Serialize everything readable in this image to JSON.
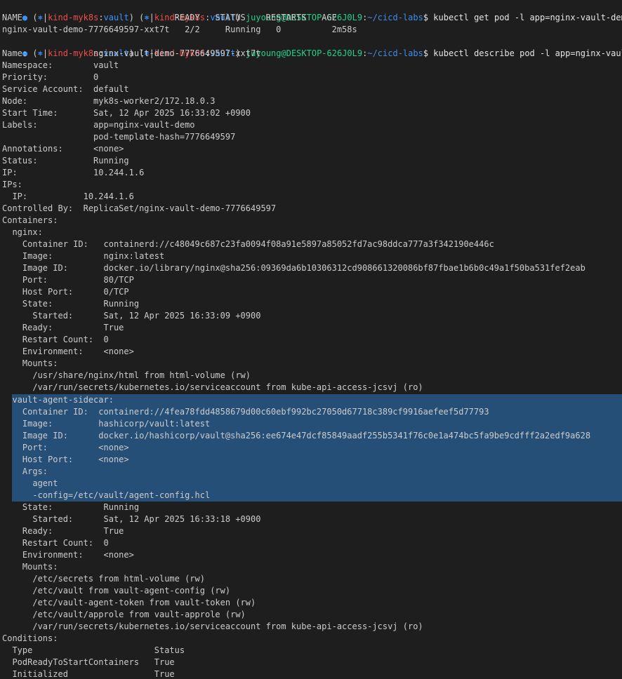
{
  "prompt": {
    "dot": "●",
    "open": "(",
    "k8s_icon": "⎈",
    "sep": "|",
    "cluster": "kind-myk8s",
    "colon": ":",
    "namespace": "vault",
    "close": ")",
    "userhost": "juyoung@DESKTOP-626J0L9",
    "path": "~/cicd-labs",
    "dollar": "$"
  },
  "commands": {
    "get": " kubectl get pod -l app=nginx-vault-demo",
    "describe": " kubectl describe pod -l app=nginx-vault-demo"
  },
  "get_output": {
    "header": "NAME                              READY   STATUS    RESTARTS   AGE",
    "row": "nginx-vault-demo-7776649597-xxt7t   2/2     Running   0          2m58s"
  },
  "describe_output": [
    "Name:             nginx-vault-demo-7776649597-xxt7t",
    "Namespace:        vault",
    "Priority:         0",
    "Service Account:  default",
    "Node:             myk8s-worker2/172.18.0.3",
    "Start Time:       Sat, 12 Apr 2025 16:33:02 +0900",
    "Labels:           app=nginx-vault-demo",
    "                  pod-template-hash=7776649597",
    "Annotations:      <none>",
    "Status:           Running",
    "IP:               10.244.1.6",
    "IPs:",
    "  IP:           10.244.1.6",
    "Controlled By:  ReplicaSet/nginx-vault-demo-7776649597",
    "Containers:",
    "  nginx:",
    "    Container ID:   containerd://c48049c687c23fa0094f08a91e5897a85052fd7ac98ddca777a3f342190e446c",
    "    Image:          nginx:latest",
    "    Image ID:       docker.io/library/nginx@sha256:09369da6b10306312cd908661320086bf87fbae1b6b0c49a1f50ba531fef2eab",
    "    Port:           80/TCP",
    "    Host Port:      0/TCP",
    "    State:          Running",
    "      Started:      Sat, 12 Apr 2025 16:33:09 +0900",
    "    Ready:          True",
    "    Restart Count:  0",
    "    Environment:    <none>",
    "    Mounts:",
    "      /usr/share/nginx/html from html-volume (rw)",
    "      /var/run/secrets/kubernetes.io/serviceaccount from kube-api-access-jcsvj (ro)",
    "  vault-agent-sidecar:",
    "    Container ID:  containerd://4fea78fdd4858679d00c60ebf992bc27050d67718c389cf9916aefeef5d77793",
    "    Image:         hashicorp/vault:latest",
    "    Image ID:      docker.io/hashicorp/vault@sha256:ee674e47dcf85849aadf255b5341f76c0e1a474bc5fa9be9cdfff2a2edf9a628",
    "    Port:          <none>",
    "    Host Port:     <none>",
    "    Args:",
    "      agent",
    "      -config=/etc/vault/agent-config.hcl",
    "    State:          Running",
    "      Started:      Sat, 12 Apr 2025 16:33:18 +0900",
    "    Ready:          True",
    "    Restart Count:  0",
    "    Environment:    <none>",
    "    Mounts:",
    "      /etc/secrets from html-volume (rw)",
    "      /etc/vault from vault-agent-config (rw)",
    "      /etc/vault-agent-token from vault-token (rw)",
    "      /etc/vault/approle from vault-approle (rw)",
    "      /var/run/secrets/kubernetes.io/serviceaccount from kube-api-access-jcsvj (ro)",
    "Conditions:",
    "  Type                        Status",
    "  PodReadyToStartContainers   True",
    "  Initialized                 True"
  ],
  "colors": {
    "background": "#1e1e1e",
    "text": "#cccccc",
    "selection": "#264f78",
    "prompt_user": "#23d18b",
    "prompt_path": "#3b8eea",
    "prompt_context": "#f14c4c",
    "prompt_dot": "#3794ff"
  }
}
